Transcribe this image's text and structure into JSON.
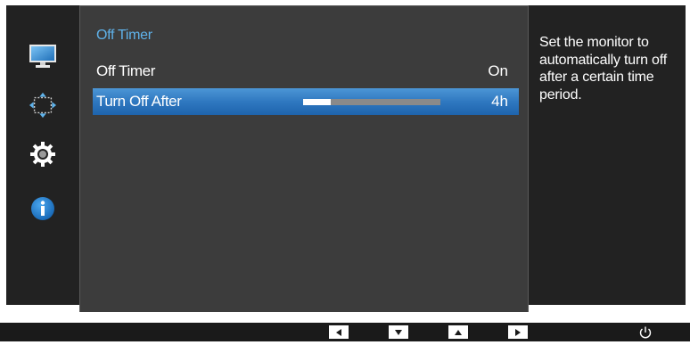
{
  "menu": {
    "title": "Off Timer",
    "items": [
      {
        "label": "Off Timer",
        "value": "On"
      },
      {
        "label": "Turn Off After",
        "value": "4h",
        "slider_fraction": 0.2
      }
    ]
  },
  "sidebar": {
    "icons": [
      "monitor-icon",
      "position-arrows-icon",
      "settings-gear-icon",
      "info-icon"
    ]
  },
  "help": {
    "text": "Set the monitor to automatically turn off after a certain time period."
  },
  "colors": {
    "title": "#5fb2ea",
    "selection": "#2f78c0",
    "background": "#222222",
    "panel": "#3c3c3c"
  },
  "bottom_bar": {
    "keys": [
      "left-arrow-icon",
      "down-arrow-icon",
      "up-arrow-icon",
      "right-arrow-icon"
    ],
    "power": "power-icon"
  }
}
